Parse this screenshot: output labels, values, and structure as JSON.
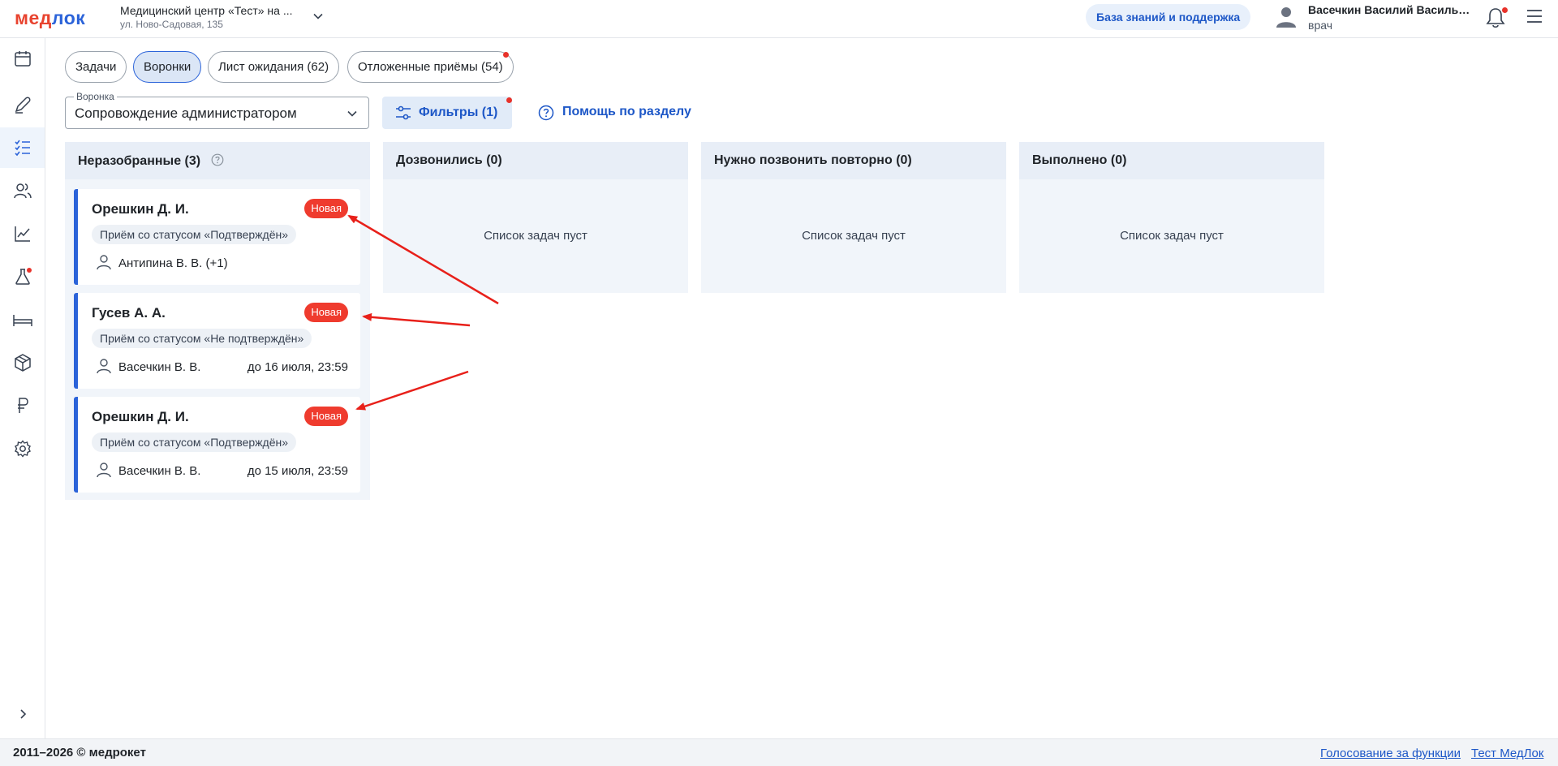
{
  "header": {
    "logo": {
      "part1": "мед",
      "part2": "лок"
    },
    "clinic_name": "Медицинский центр «Тест» на ...",
    "clinic_address": "ул. Ново-Садовая, 135",
    "kb_button": "База знаний и поддержка",
    "user_name": "Васечкин Василий Васильевич",
    "user_role": "врач"
  },
  "sidebar": {
    "items": [
      "calendar-icon",
      "pen-icon",
      "tasks-icon",
      "users-icon",
      "chart-icon",
      "flask-icon",
      "bed-icon",
      "box-icon",
      "ruble-icon",
      "settings-icon"
    ],
    "active": "tasks-icon",
    "badge_item": "flask-icon",
    "expand": "chevron-right-icon"
  },
  "tabs": [
    {
      "label": "Задачи",
      "active": false
    },
    {
      "label": "Воронки",
      "active": true
    },
    {
      "label": "Лист ожидания (62)",
      "active": false
    },
    {
      "label": "Отложенные приёмы (54)",
      "active": false
    }
  ],
  "toolbar": {
    "funnel_label": "Воронка",
    "funnel_value": "Сопровождение администратором",
    "filters_label": "Фильтры (1)",
    "help_label": "Помощь по разделу"
  },
  "columns": [
    {
      "title": "Неразобранные (3)",
      "empty_text": ""
    },
    {
      "title": "Дозвонились (0)",
      "empty_text": "Список задач пуст"
    },
    {
      "title": "Нужно позвонить повторно (0)",
      "empty_text": "Список задач пуст"
    },
    {
      "title": "Выполнено (0)",
      "empty_text": "Список задач пуст"
    }
  ],
  "cards": [
    {
      "name": "Орешкин Д. И.",
      "badge": "Новая",
      "status": "Приём со статусом «Подтверждён»",
      "doctor": "Антипина В. В. (+1)",
      "deadline": ""
    },
    {
      "name": "Гусев А. А.",
      "badge": "Новая",
      "status": "Приём со статусом «Не подтверждён»",
      "doctor": "Васечкин В. В.",
      "deadline": "до 16 июля, 23:59"
    },
    {
      "name": "Орешкин Д. И.",
      "badge": "Новая",
      "status": "Приём со статусом «Подтверждён»",
      "doctor": "Васечкин В. В.",
      "deadline": "до 15 июля, 23:59"
    }
  ],
  "footer": {
    "copyright": "2011–2026 © медрокет",
    "links": [
      "Голосование за функции",
      "Тест МедЛок"
    ]
  },
  "colors": {
    "accent": "#2b63d9",
    "badge_red": "#ef3b2e",
    "annotation_arrow": "#e8201a"
  }
}
